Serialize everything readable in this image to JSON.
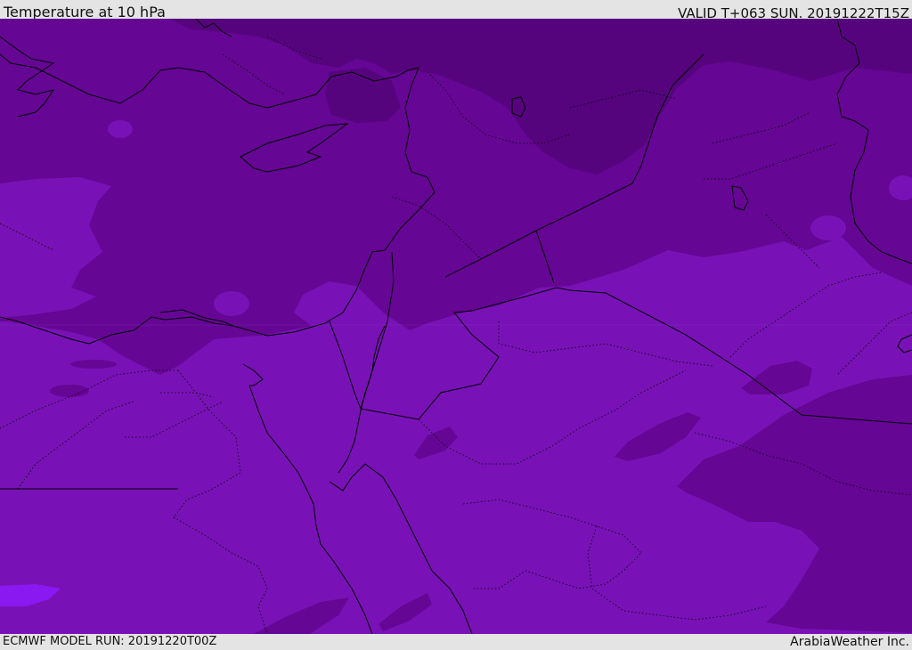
{
  "header": {
    "title": "Temperature at 10 hPa",
    "valid_time": "VALID T+063 SUN. 20191222T15Z"
  },
  "footer": {
    "model_run": "ECMWF MODEL RUN: 20191220T00Z",
    "provider": "ArabiaWeather Inc."
  },
  "map": {
    "field_colors": {
      "very_cold": "#56047e",
      "cold": "#650694",
      "cool": "#7812b6",
      "warm": "#8a18f0"
    },
    "border_color": "#000000"
  }
}
